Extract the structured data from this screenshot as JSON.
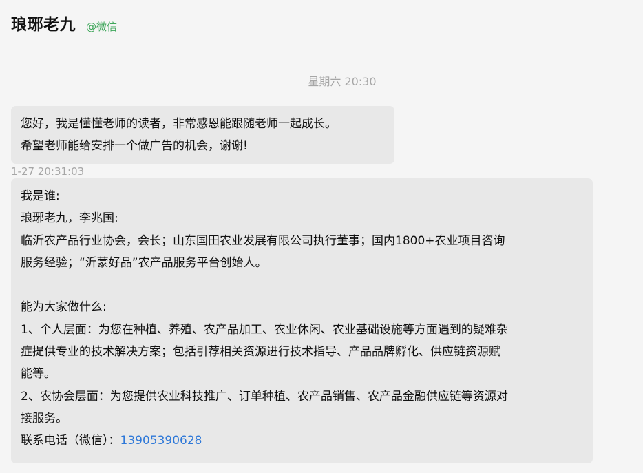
{
  "header": {
    "title": "琅琊老九",
    "subtitle": "@微信"
  },
  "conversation": {
    "day_stamp": "星期六 20:30",
    "messages": [
      {
        "lines": [
          "您好，我是懂懂老师的读者，非常感恩能跟随老师一起成长。",
          "希望老师能给安排一个做广告的机会，谢谢!"
        ],
        "time": "1-27 20:31:03"
      },
      {
        "lines": [
          "我是谁:",
          "琅琊老九，李兆国:",
          "临沂农产品行业协会，会长；山东国田农业发展有限公司执行董事；国内1800+农业项目咨询",
          "服务经验；“沂蒙好品”农产品服务平台创始人。",
          "",
          "能为大家做什么:",
          "1、个人层面：为您在种植、养殖、农产品加工、农业休闲、农业基础设施等方面遇到的疑难杂",
          "症提供专业的技术解决方案；包括引荐相关资源进行技术指导、产品品牌孵化、供应链资源赋",
          "能等。",
          "2、农协会层面：为您提供农业科技推广、订单种植、农产品销售、农产品金融供应链等资源对",
          "接服务。"
        ],
        "contact_label": "联系电话（微信）：",
        "contact_phone": "13905390628"
      }
    ]
  },
  "colors": {
    "background": "#f5f5f5",
    "bubble": "#e8e8e8",
    "subtitle_green": "#3ea65a",
    "link_blue": "#2e78d8",
    "muted_gray": "#a6a6a6"
  }
}
